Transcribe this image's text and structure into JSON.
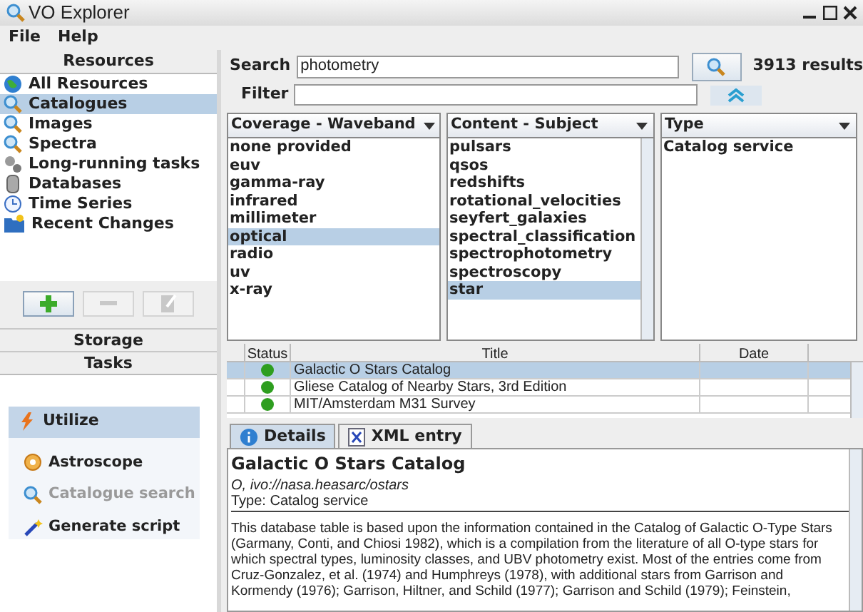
{
  "window": {
    "title": "VO Explorer"
  },
  "menu": [
    "File",
    "Help"
  ],
  "resources": {
    "header": "Resources",
    "items": [
      {
        "label": "All Resources",
        "selected": false
      },
      {
        "label": "Catalogues",
        "selected": true
      },
      {
        "label": "Images",
        "selected": false
      },
      {
        "label": "Spectra",
        "selected": false
      },
      {
        "label": "Long-running tasks",
        "selected": false
      },
      {
        "label": "Databases",
        "selected": false
      },
      {
        "label": "Time Series",
        "selected": false
      },
      {
        "label": "Recent Changes",
        "selected": false
      }
    ]
  },
  "resource_buttons": [
    {
      "kind": "add",
      "disabled": false
    },
    {
      "kind": "remove",
      "disabled": true
    },
    {
      "kind": "edit",
      "disabled": true
    }
  ],
  "sections": [
    "Storage",
    "Tasks"
  ],
  "tasks": {
    "header": "Utilize",
    "items": [
      {
        "label": "Astroscope",
        "disabled": false
      },
      {
        "label": "Catalogue search",
        "disabled": true
      },
      {
        "label": "Generate script",
        "disabled": false
      }
    ]
  },
  "search": {
    "label": "Search",
    "value": "photometry",
    "results": "3913 results"
  },
  "filter": {
    "label": "Filter"
  },
  "facets": [
    {
      "title": "Coverage - Waveband",
      "items": [
        {
          "label": "none provided",
          "selected": false
        },
        {
          "label": "euv",
          "selected": false
        },
        {
          "label": "gamma-ray",
          "selected": false
        },
        {
          "label": "infrared",
          "selected": false
        },
        {
          "label": "millimeter",
          "selected": false
        },
        {
          "label": "optical",
          "selected": true
        },
        {
          "label": "radio",
          "selected": false
        },
        {
          "label": "uv",
          "selected": false
        },
        {
          "label": "x-ray",
          "selected": false
        }
      ]
    },
    {
      "title": "Content - Subject",
      "items": [
        {
          "label": "pulsars",
          "selected": false
        },
        {
          "label": "qsos",
          "selected": false
        },
        {
          "label": "redshifts",
          "selected": false
        },
        {
          "label": "rotational_velocities",
          "selected": false
        },
        {
          "label": "seyfert_galaxies",
          "selected": false
        },
        {
          "label": "spectral_classification",
          "selected": false
        },
        {
          "label": "spectrophotometry",
          "selected": false
        },
        {
          "label": "spectroscopy",
          "selected": false
        },
        {
          "label": "star",
          "selected": true
        }
      ]
    },
    {
      "title": "Type",
      "items": [
        {
          "label": "Catalog service",
          "selected": false
        }
      ]
    }
  ],
  "table": {
    "columns": [
      "Status",
      "Title",
      "Date"
    ],
    "rows": [
      {
        "color": "#2e9e1f",
        "title": "Galactic O Stars Catalog",
        "selected": true
      },
      {
        "color": "#2e9e1f",
        "title": "Gliese Catalog of Nearby Stars, 3rd Edition",
        "selected": false
      },
      {
        "color": "#2e9e1f",
        "title": "MIT/Amsterdam M31 Survey",
        "selected": false
      }
    ]
  },
  "tabs": [
    {
      "label": "Details",
      "selected": true
    },
    {
      "label": "XML entry",
      "selected": false
    }
  ],
  "details": {
    "heading": "Galactic O Stars Catalog",
    "identifier": "O, ivo://nasa.heasarc/ostars",
    "type": "Type: Catalog service",
    "description": "This database table is based upon the information contained in the Catalog of Galactic O-Type Stars (Garmany, Conti, and Chiosi 1982), which is a compilation from the literature of all O-type stars for which spectral types, luminosity classes, and UBV photometry exist. Most of the entries come from Cruz-Gonzalez, et al. (1974) and Humphreys (1978), with additional stars from Garrison and Kormendy (1976); Garrison, Hiltner, and Schild (1977); Garrison and Schild (1979); Feinstein,"
  }
}
